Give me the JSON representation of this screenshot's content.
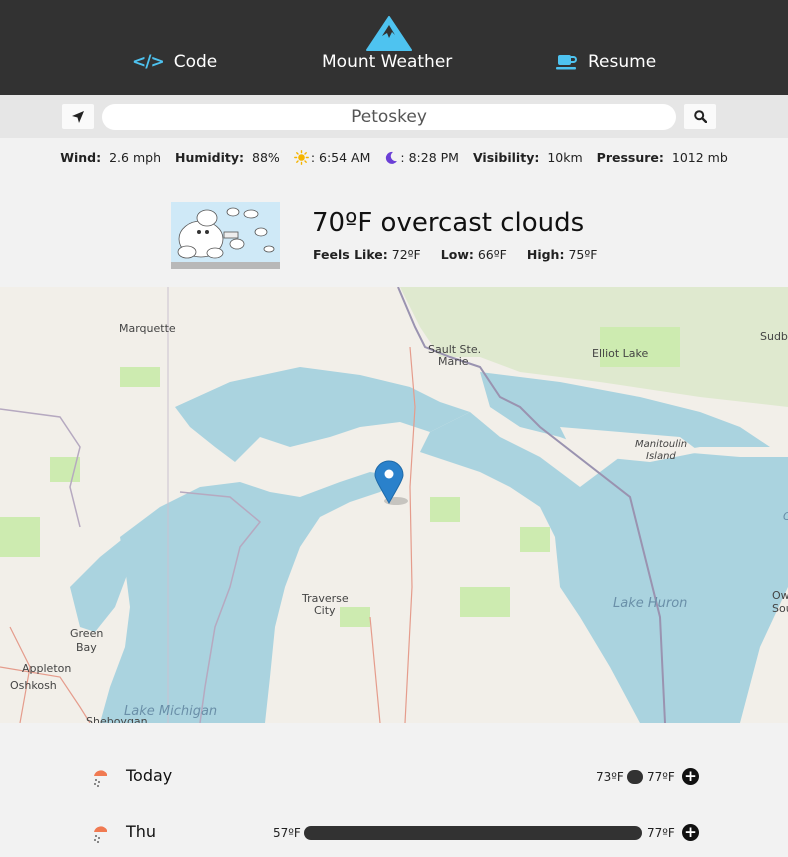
{
  "header": {
    "code_label": "Code",
    "title": "Mount Weather",
    "resume_label": "Resume",
    "code_icon_glyph": "</>",
    "brand_color": "#4ec3f0"
  },
  "search": {
    "value": "Petoskey",
    "placeholder": ""
  },
  "stats": {
    "wind_label": "Wind:",
    "wind_value": "2.6 mph",
    "humidity_label": "Humidity:",
    "humidity_value": "88%",
    "sunrise_value": ": 6:54 AM",
    "sunset_value": ": 8:28 PM",
    "visibility_label": "Visibility:",
    "visibility_value": "10km",
    "pressure_label": "Pressure:",
    "pressure_value": "1012 mb"
  },
  "current": {
    "headline": "70ºF overcast clouds",
    "feels_label": "Feels Like:",
    "feels_value": "72ºF",
    "low_label": "Low:",
    "low_value": "66ºF",
    "high_label": "High:",
    "high_value": "75ºF"
  },
  "map": {
    "labels": {
      "marquette": "Marquette",
      "sault": "Sault Ste.",
      "marie": "Marie",
      "elliot": "Elliot Lake",
      "sudb": "Sudb",
      "manitoulin": "Manitoulin",
      "island": "Island",
      "traverse": "Traverse",
      "city": "City",
      "green": "Green",
      "bay": "Bay",
      "appleton": "Appleton",
      "oshkosh": "Oshkosh",
      "sheboygan": "Sheboygan",
      "lake_michigan": "Lake Michigan",
      "lake_huron": "Lake Huron",
      "ow": "Ow",
      "sou": "Sou",
      "c": "C"
    },
    "marker_color": "#2a81cb"
  },
  "forecast": [
    {
      "day": "Today",
      "low": "73ºF",
      "high": "77ºF",
      "icon": "rain-icon"
    },
    {
      "day": "Thu",
      "low": "57ºF",
      "high": "77ºF",
      "icon": "rain-icon"
    }
  ]
}
